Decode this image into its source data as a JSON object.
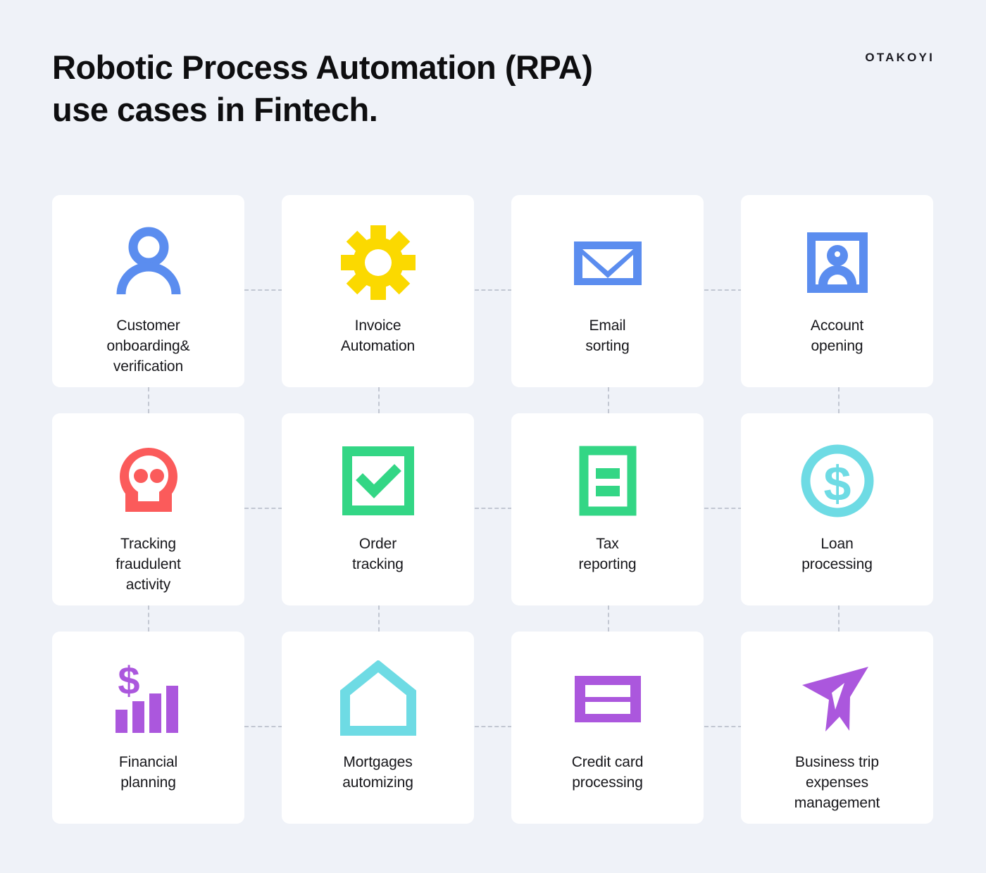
{
  "header": {
    "title": "Robotic Process Automation (RPA)\nuse cases in Fintech.",
    "brand": "OTAKOYI"
  },
  "colors": {
    "background": "#eff2f8",
    "card": "#ffffff",
    "text": "#16161a",
    "title": "#0e0e10",
    "connector": "#c2c7d2",
    "blue": "#5b8def",
    "yellow": "#fbd900",
    "red": "#fb5b5b",
    "green": "#33d685",
    "cyan": "#6edbe4",
    "purple": "#ab57dd"
  },
  "cards": [
    {
      "icon": "person-icon",
      "color": "#5b8def",
      "label": "Customer\nonboarding&\nverification"
    },
    {
      "icon": "gear-icon",
      "color": "#fbd900",
      "label": "Invoice\nAutomation"
    },
    {
      "icon": "envelope-icon",
      "color": "#5b8def",
      "label": "Email\nsorting"
    },
    {
      "icon": "id-card-icon",
      "color": "#5b8def",
      "label": "Account\nopening"
    },
    {
      "icon": "skull-icon",
      "color": "#fb5b5b",
      "label": "Tracking\nfraudulent\nactivity"
    },
    {
      "icon": "check-square-icon",
      "color": "#33d685",
      "label": "Order\ntracking"
    },
    {
      "icon": "document-icon",
      "color": "#33d685",
      "label": "Tax\nreporting"
    },
    {
      "icon": "dollar-coin-icon",
      "color": "#6edbe4",
      "label": "Loan\nprocessing"
    },
    {
      "icon": "dollar-chart-icon",
      "color": "#ab57dd",
      "label": "Financial\nplanning"
    },
    {
      "icon": "house-icon",
      "color": "#6edbe4",
      "label": "Mortgages\nautomizing"
    },
    {
      "icon": "credit-card-icon",
      "color": "#ab57dd",
      "label": "Credit card\nprocessing"
    },
    {
      "icon": "paper-plane-icon",
      "color": "#ab57dd",
      "label": "Business trip\nexpenses\nmanagement"
    }
  ]
}
